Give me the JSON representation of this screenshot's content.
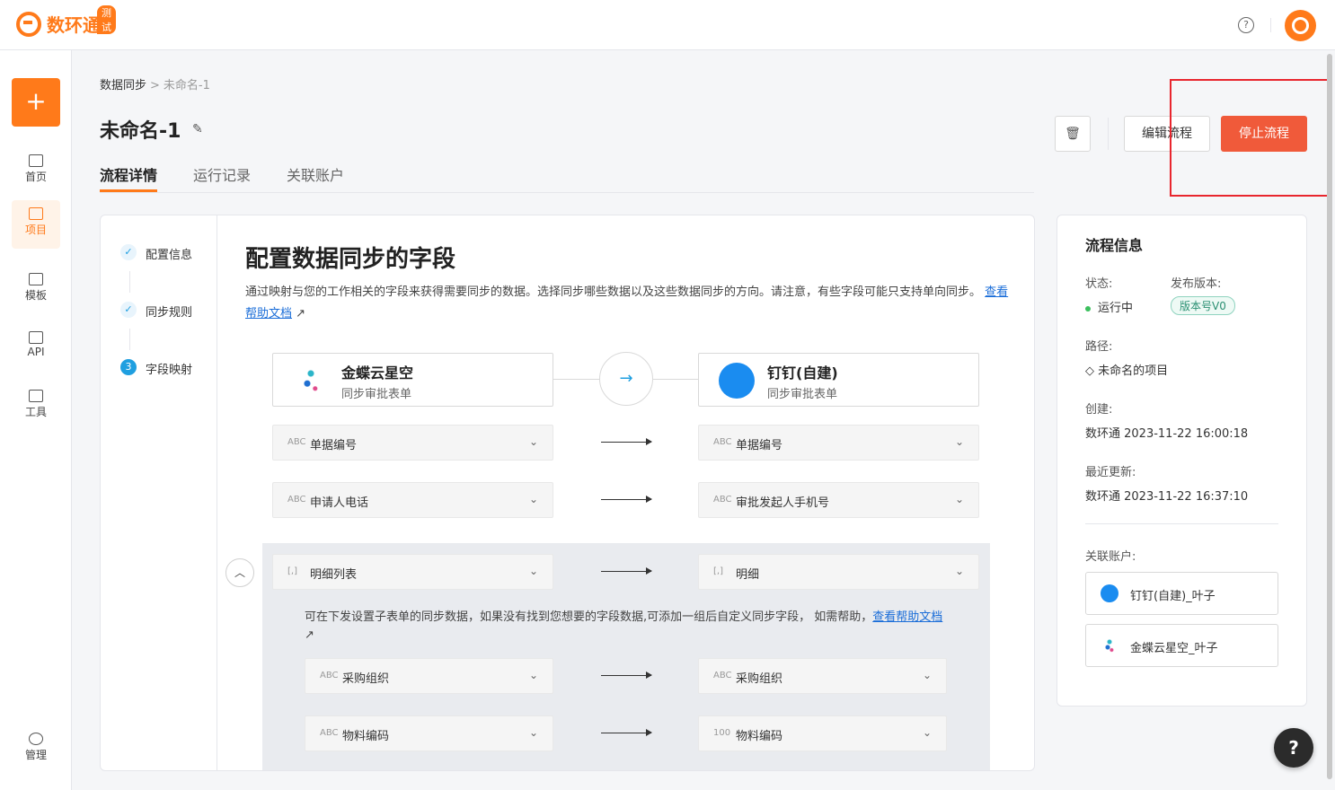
{
  "app": {
    "logo_text": "数环通",
    "badge": "测试"
  },
  "topbar": {
    "help_glyph": "?"
  },
  "sidebar": {
    "add_glyph": "+",
    "items": [
      {
        "label": "首页",
        "icon": "home-icon"
      },
      {
        "label": "项目",
        "icon": "layers-icon"
      },
      {
        "label": "模板",
        "icon": "grid-icon"
      },
      {
        "label": "API",
        "icon": "api-icon"
      },
      {
        "label": "工具",
        "icon": "sliders-icon"
      },
      {
        "label": "管理",
        "icon": "gear-icon"
      }
    ]
  },
  "breadcrumb": {
    "parent": "数据同步",
    "sep": ">",
    "current": "未命名-1"
  },
  "page": {
    "title": "未命名-1"
  },
  "tabs": [
    "流程详情",
    "运行记录",
    "关联账户"
  ],
  "actions": {
    "edit": "编辑流程",
    "stop": "停止流程"
  },
  "steps": [
    {
      "label": "配置信息",
      "mark": "✓"
    },
    {
      "label": "同步规则",
      "mark": "✓"
    },
    {
      "label": "字段映射",
      "mark": "3"
    }
  ],
  "config": {
    "title": "配置数据同步的字段",
    "desc": "通过映射与您的工作相关的字段来获得需要同步的数据。选择同步哪些数据以及这些数据同步的方向。请注意，有些字段可能只支持单向同步。",
    "help_link": "查看帮助文档",
    "source": {
      "name": "金蝶云星空",
      "sub": "同步审批表单"
    },
    "target": {
      "name": "钉钉(自建)",
      "sub": "同步审批表单"
    },
    "arrow_glyph": "→"
  },
  "mappings": [
    {
      "src_type": "ABC",
      "src": "单据编号",
      "dst_type": "ABC",
      "dst": "单据编号"
    },
    {
      "src_type": "ABC",
      "src": "申请人电话",
      "dst_type": "ABC",
      "dst": "审批发起人手机号"
    }
  ],
  "subtable": {
    "src_type": "[,]",
    "src": "明细列表",
    "dst_type": "[,]",
    "dst": "明细",
    "note": "可在下发设置子表单的同步数据，如果没有找到您想要的字段数据,可添加一组后自定义同步字段， 如需帮助，",
    "note_link": "查看帮助文档",
    "rows": [
      {
        "src_type": "ABC",
        "src": "采购组织",
        "dst_type": "ABC",
        "dst": "采购组织"
      },
      {
        "src_type": "ABC",
        "src": "物料编码",
        "dst_type": "100",
        "dst": "物料编码"
      }
    ]
  },
  "info": {
    "title": "流程信息",
    "status_label": "状态:",
    "status": "运行中",
    "version_label": "发布版本:",
    "version": "版本号V0",
    "path_label": "路径:",
    "path": "未命名的项目",
    "created_label": "创建:",
    "created": "数环通 2023-11-22 16:00:18",
    "updated_label": "最近更新:",
    "updated": "数环通 2023-11-22 16:37:10",
    "accounts_label": "关联账户:",
    "accounts": [
      "钉钉(自建)_叶子",
      "金蝶云星空_叶子"
    ]
  },
  "colors": {
    "brand": "#ff7a1a",
    "stop": "#f05a3a",
    "link": "#1a6dd8",
    "highlight": "#e8262e"
  }
}
